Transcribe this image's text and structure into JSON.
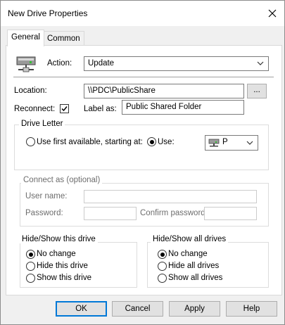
{
  "window": {
    "title": "New Drive Properties"
  },
  "tabs": [
    {
      "label": "General",
      "active": true
    },
    {
      "label": "Common",
      "active": false
    }
  ],
  "action": {
    "label": "Action:",
    "value": "Update"
  },
  "location": {
    "label": "Location:",
    "value": "\\\\PDC\\PublicShare",
    "browse_label": "..."
  },
  "reconnect": {
    "label": "Reconnect:",
    "checked": true
  },
  "label_as": {
    "label": "Label as:",
    "value": "Public Shared Folder"
  },
  "drive_letter": {
    "group_title": "Drive Letter",
    "first_available_label": "Use first available, starting at:",
    "use_label": "Use:",
    "use_selected": true,
    "drive_value": "P"
  },
  "connect_as": {
    "group_title": "Connect as (optional)",
    "username_label": "User name:",
    "password_label": "Password:",
    "confirm_label": "Confirm password:"
  },
  "hide_show_drive": {
    "group_title": "Hide/Show this drive",
    "options": [
      "No change",
      "Hide this drive",
      "Show this drive"
    ],
    "selected": 0
  },
  "hide_show_all": {
    "group_title": "Hide/Show all drives",
    "options": [
      "No change",
      "Hide all drives",
      "Show all drives"
    ],
    "selected": 0
  },
  "buttons": {
    "ok": "OK",
    "cancel": "Cancel",
    "apply": "Apply",
    "help": "Help"
  },
  "colors": {
    "default_button_border": "#0078d7",
    "dialog_bg": "#f0f0f0"
  },
  "icons": {
    "close": "close-icon",
    "action": "network-drive-icon",
    "drive": "network-drive-icon",
    "dropdown": "chevron-down-icon"
  }
}
